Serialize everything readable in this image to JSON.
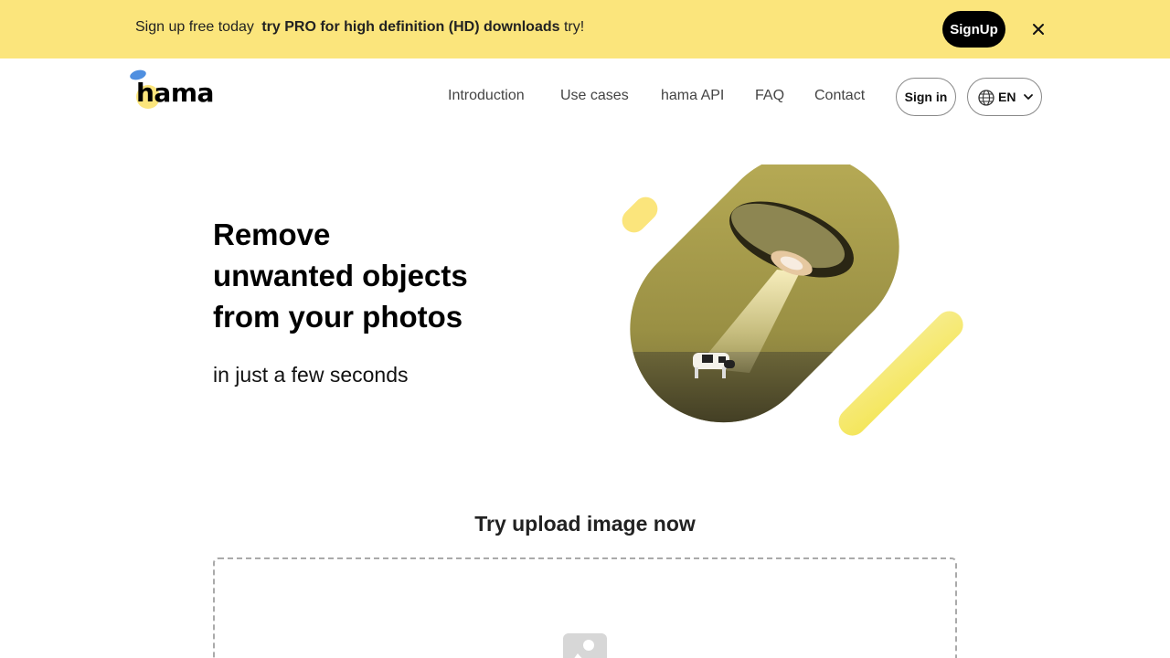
{
  "banner": {
    "text_prefix": "Sign up free today",
    "text_strong": "try PRO for high definition (HD) downloads",
    "text_suffix": "try!",
    "signup_label": "SignUp",
    "close_icon": "close-icon"
  },
  "header": {
    "logo_text": "hama",
    "nav": [
      {
        "label": "Introduction"
      },
      {
        "label": "Use cases"
      },
      {
        "label": "hama API"
      },
      {
        "label": "FAQ"
      },
      {
        "label": "Contact"
      }
    ],
    "signin_label": "Sign in",
    "language": "EN"
  },
  "hero": {
    "line1": "Remove",
    "line2": "unwanted objects",
    "line3": "from your photos",
    "subtitle": "in just a few seconds"
  },
  "upload": {
    "heading": "Try upload image now"
  },
  "colors": {
    "accent": "#fbe57c",
    "button_dark": "#000000"
  }
}
